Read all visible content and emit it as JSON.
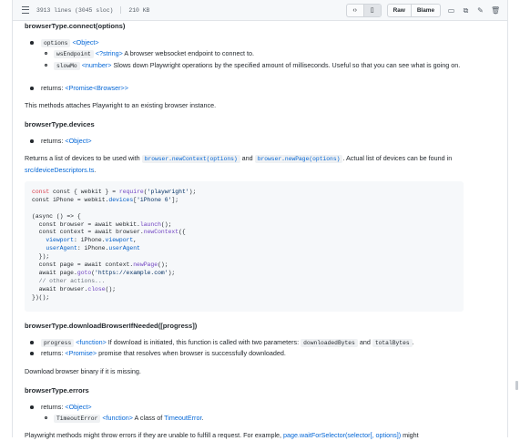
{
  "filebar": {
    "lines": "3913 lines (3045 sloc)",
    "size": "210 KB",
    "raw": "Raw",
    "blame": "Blame"
  },
  "connect": {
    "heading": "browserType.connect(options)",
    "options_code": "options",
    "options_type": "<Object>",
    "ws_code": "wsEndpoint",
    "ws_type_pre": "<?",
    "ws_type_link": "string",
    "ws_type_post": ">",
    "ws_desc": " A browser websocket endpoint to connect to.",
    "slowmo_code": "slowMo",
    "slowmo_type": "<number>",
    "slowmo_desc": " Slows down Playwright operations by the specified amount of milliseconds. Useful so that you can see what is going on.",
    "returns_label": "returns: ",
    "returns_promise": "<Promise",
    "returns_lt": "<",
    "returns_browser": "Browser",
    "returns_gt": ">>",
    "desc": "This methods attaches Playwright to an existing browser instance."
  },
  "devices": {
    "heading": "browserType.devices",
    "returns_label": "returns: ",
    "returns_type": "<Object>",
    "desc_1": "Returns a list of devices to be used with ",
    "code_1": "browser.newContext(options)",
    "desc_2": " and ",
    "code_2": "browser.newPage(options)",
    "desc_3": ". Actual list of devices can be found in ",
    "desc_link": "src/deviceDescriptors.ts",
    "desc_4": "."
  },
  "code": {
    "l1_a": "const { webkit } = ",
    "l1_b": "require",
    "l1_c": "(",
    "l1_d": "'playwright'",
    "l1_e": ");",
    "l2_a": "const iPhone = webkit.",
    "l2_b": "devices",
    "l2_c": "[",
    "l2_d": "'iPhone 6'",
    "l2_e": "];",
    "l4": "(async () => {",
    "l5_a": "  const browser = await webkit.",
    "l5_b": "launch",
    "l5_c": "();",
    "l6_a": "  const context = await browser.",
    "l6_b": "newContext",
    "l6_c": "({",
    "l7_a": "    viewport",
    "l7_b": ": iPhone.",
    "l7_c": "viewport",
    "l7_d": ",",
    "l8_a": "    userAgent",
    "l8_b": ": iPhone.",
    "l8_c": "userAgent",
    "l9": "  });",
    "l10_a": "  const page = await context.",
    "l10_b": "newPage",
    "l10_c": "();",
    "l11_a": "  await page.",
    "l11_b": "goto",
    "l11_c": "(",
    "l11_d": "'https://example.com'",
    "l11_e": ");",
    "l12": "  // other actions...",
    "l13_a": "  await browser.",
    "l13_b": "close",
    "l13_c": "();",
    "l14": "})();"
  },
  "download": {
    "heading": "browserType.downloadBrowserIfNeeded([progress])",
    "progress_code": "progress",
    "progress_type": "<function>",
    "progress_desc_1": " If download is initiated, this function is called with two parameters: ",
    "code_a": "downloadedBytes",
    "and": " and ",
    "code_b": "totalBytes",
    "period": ".",
    "returns_label": "returns: ",
    "returns_type": "<Promise>",
    "returns_desc": " promise that resolves when browser is successfully downloaded.",
    "desc": "Download browser binary if it is missing."
  },
  "errors": {
    "heading": "browserType.errors",
    "returns_label": "returns: ",
    "returns_type": "<Object>",
    "timeout_code": "TimeoutError",
    "timeout_type": "<function>",
    "timeout_desc": " A class of ",
    "timeout_link": "TimeoutError",
    "timeout_end": ".",
    "desc_1": "Playwright methods might throw errors if they are unable to fulfill a request. For example, ",
    "desc_link": "page.waitForSelector(selector[, options])",
    "desc_2": " might"
  }
}
